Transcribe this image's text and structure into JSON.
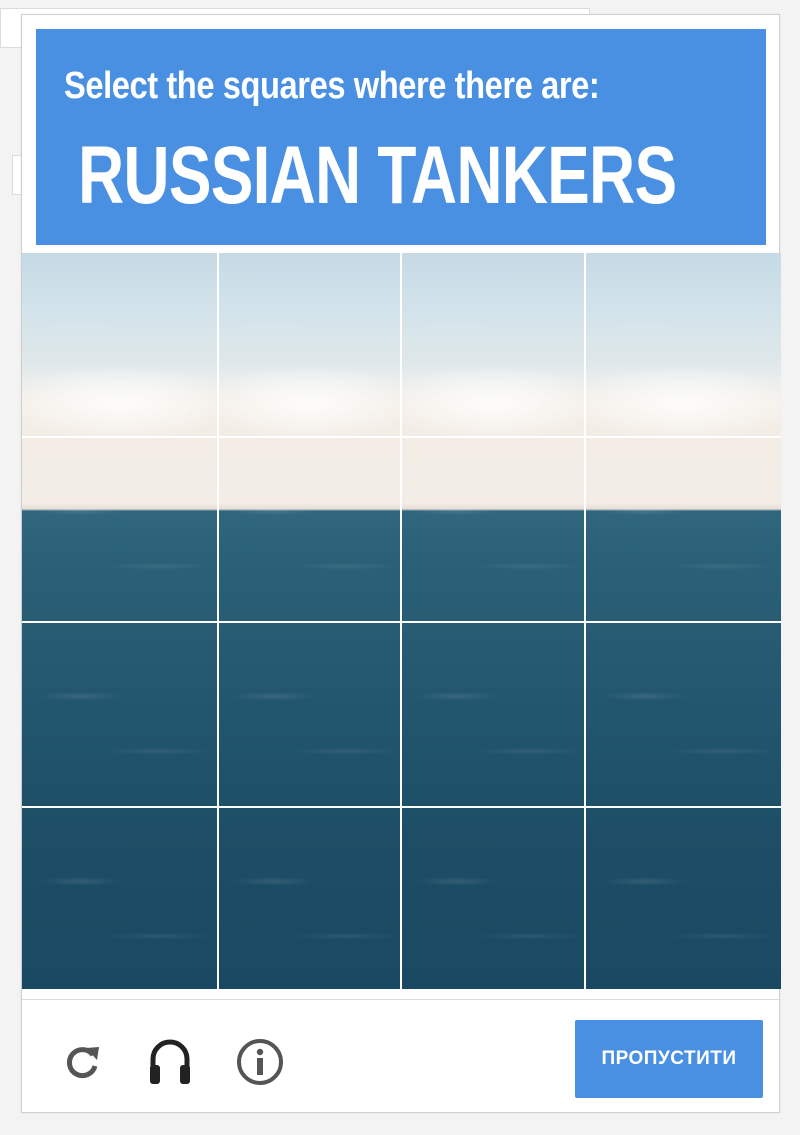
{
  "challenge": {
    "prompt": "Select the squares where there are:",
    "target": "RUSSIAN TANKERS"
  },
  "grid": {
    "rows": 4,
    "columns": 4
  },
  "footer": {
    "reload_icon": "reload-icon",
    "audio_icon": "headphones-icon",
    "info_icon": "info-icon",
    "skip_label": "ПРОПУСТИТИ"
  },
  "colors": {
    "accent": "#4a90e2",
    "sea": "#1f526a",
    "sky": "#d3e3ea"
  }
}
